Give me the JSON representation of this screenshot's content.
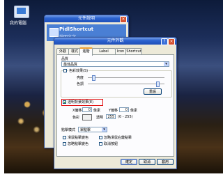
{
  "desktop": {
    "icon_label": "我的電腦"
  },
  "back_window": {
    "title": "元件說明",
    "band_title": "PidlShortcut",
    "band_subtitle": "說明文字"
  },
  "dialog": {
    "title": "元件外觀",
    "help_glyph": "?",
    "close_glyph": "×",
    "tabs": [
      "外觀",
      "樣式",
      "進階",
      "Label Format",
      "Icon",
      "Shortcut"
    ],
    "active_tab": "進階",
    "appearance_label": "品質",
    "appearance_value": "最佳品質",
    "color_effect_checkbox": "色彩效果(S)",
    "brightness_label": "亮度",
    "color_label": "色調",
    "reset_button": "重設",
    "transparent_checkbox": "透明背景效果(E)",
    "x_offset_label": "X偏移",
    "x_offset_value": "0",
    "x_unit": "像素",
    "y_offset_label": "Y偏移",
    "y_offset_value": "0",
    "y_unit": "像素",
    "color_box_label": "色彩",
    "alpha_label": "透明",
    "alpha_value": "255",
    "alpha_range": "(0 - 255)",
    "mode_label": "點擊模式",
    "mode_value": "單點擊",
    "option1": "滑鼠點擊變色",
    "option2": "忽略點擊變色",
    "option3": "取消按鈕",
    "option4": "忽略滑鼠右鍵點擊",
    "ok_button": "確定",
    "cancel_button": "取消",
    "apply_button": "套用"
  },
  "colors": {
    "titlebar": "#2c63d0",
    "highlight_box": "#e01010",
    "dialog_bg": "#ece9d8"
  }
}
